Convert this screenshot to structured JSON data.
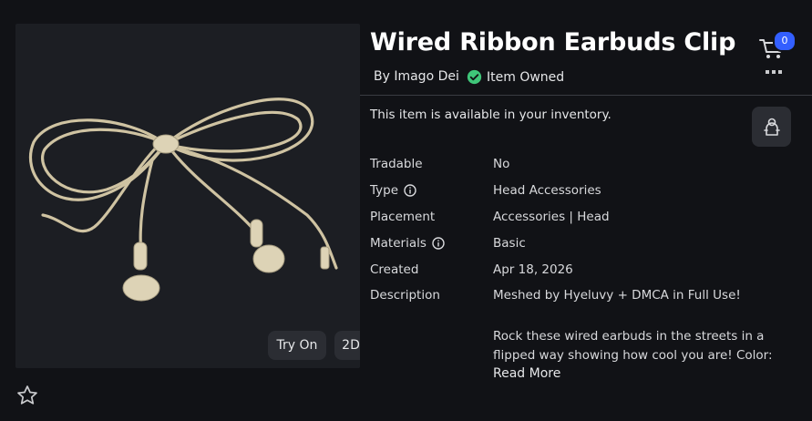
{
  "item": {
    "title": "Wired Ribbon Earbuds Clip",
    "byline": "By Imago Dei",
    "owned_label": "Item Owned",
    "availability": "This item is available in your inventory."
  },
  "preview": {
    "try_on_label": "Try On",
    "mode_label": "2D"
  },
  "cart": {
    "count": "0"
  },
  "details": {
    "tradable": {
      "label": "Tradable",
      "value": "No"
    },
    "type": {
      "label": "Type",
      "value": "Head Accessories"
    },
    "placement": {
      "label": "Placement",
      "value": "Accessories | Head"
    },
    "materials": {
      "label": "Materials",
      "value": "Basic"
    },
    "created": {
      "label": "Created",
      "value": "Apr 18, 2026"
    },
    "description": {
      "label": "Description",
      "line1": "Meshed by Hyeluvy + DMCA in Full Use!",
      "line2": "Rock these wired earbuds in the streets in a",
      "line3": "flipped way showing how cool you are! Color:",
      "read_more": "Read More"
    }
  },
  "colors": {
    "accent": "#335fff",
    "owned": "#3fc679",
    "background": "#111216"
  }
}
